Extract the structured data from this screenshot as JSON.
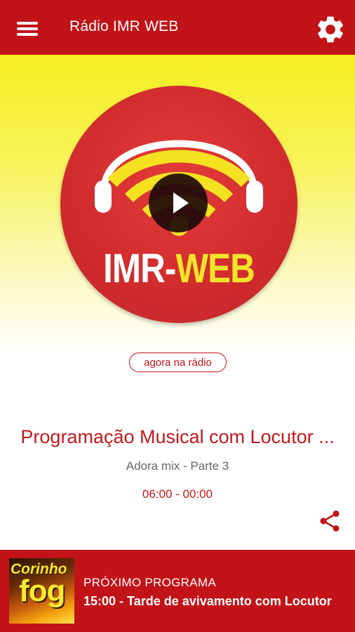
{
  "appbar": {
    "title": "Rádio IMR WEB",
    "menu_icon": "hamburger-menu-icon",
    "settings_icon": "gear-icon",
    "background": "#c21318"
  },
  "player": {
    "logo": {
      "text_part1": "IMR-",
      "text_part2": "WEB"
    },
    "play_icon": "play-icon",
    "badge": "agora na rádio"
  },
  "current_program": {
    "title": "Programação Musical com Locutor ...",
    "subtitle": "Adora mix - Parte 3",
    "time": "06:00 - 00:00",
    "share_icon": "share-icon",
    "accent": "#c0191c"
  },
  "next_program": {
    "label": "PRÓXIMO PROGRAMA",
    "title": "15:00 - Tarde de avivamento com Locutor",
    "thumbnail": {
      "line1": "Corinho",
      "line2": "fog"
    }
  }
}
